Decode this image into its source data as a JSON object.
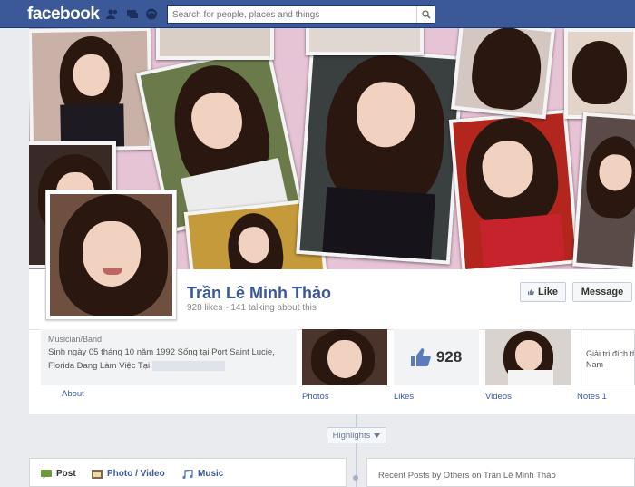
{
  "topbar": {
    "logo": "facebook",
    "search_placeholder": "Search for people, places and things"
  },
  "profile": {
    "name": "Trần Lê Minh Thảo",
    "stats": "928 likes · 141 talking about this",
    "like_label": "Like",
    "message_label": "Message"
  },
  "about": {
    "category": "Musician/Band",
    "line1": "Sinh ngày 05 tháng 10 năm 1992 Sống tại Port Saint Lucie,",
    "line2": "Florida Đang Làm Việc Tại",
    "label": "About"
  },
  "apps": {
    "photos": "Photos",
    "likes": "Likes",
    "likes_count": "928",
    "videos": "Videos",
    "notes": "Notes",
    "notes_count": "1",
    "notes_line1": "Giải trí đích th",
    "notes_line2": "Nam"
  },
  "timeline": {
    "highlights": "Highlights"
  },
  "composer": {
    "post": "Post",
    "photo_video": "Photo / Video",
    "music": "Music"
  },
  "recent": {
    "text": "Recent Posts by Others on Trần Lê Minh Thảo"
  },
  "colors": {
    "brand": "#3b5998",
    "cover_bg": "#e7c3d6"
  }
}
